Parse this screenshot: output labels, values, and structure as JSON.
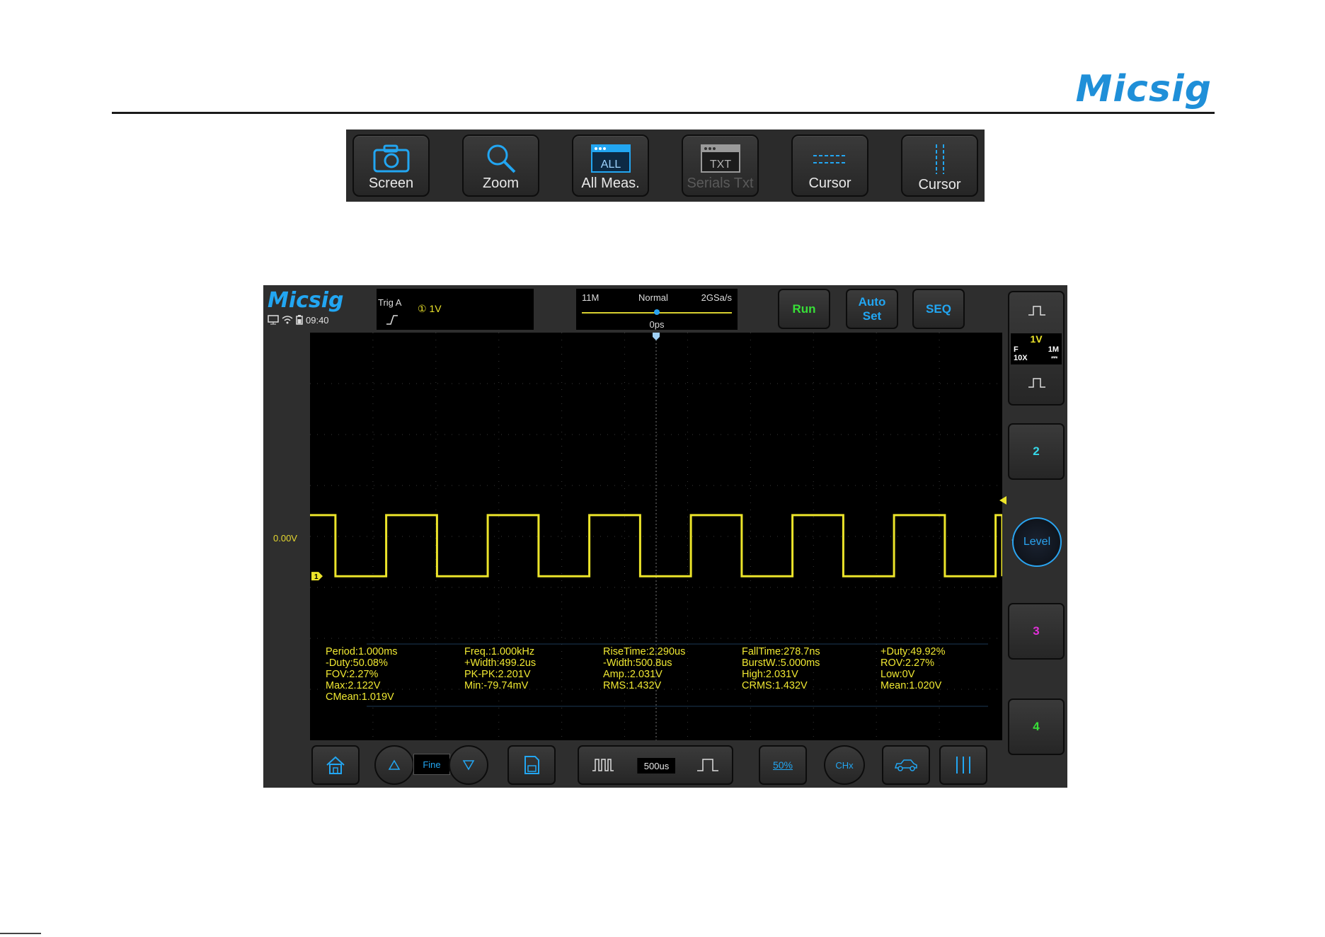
{
  "page": {
    "brand": "Micsig"
  },
  "toolbar": {
    "items": [
      {
        "label": "Screen",
        "icon": "camera-icon",
        "enabled": true
      },
      {
        "label": "Zoom",
        "icon": "magnifier-icon",
        "enabled": true
      },
      {
        "label": "All Meas.",
        "icon": "all-meas-icon",
        "badge": "ALL",
        "enabled": true
      },
      {
        "label": "Serials Txt",
        "icon": "txt-icon",
        "badge": "TXT",
        "enabled": false
      },
      {
        "label": "Cursor",
        "icon": "horizontal-cursor-icon",
        "enabled": true
      },
      {
        "label": "Cursor",
        "icon": "vertical-cursor-icon",
        "enabled": true
      }
    ]
  },
  "scope": {
    "logo": "Micsig",
    "time": "09:40",
    "trigger": {
      "label": "Trig  A",
      "channel_level": "① 1V"
    },
    "horizontal": {
      "memory_depth": "11M",
      "mode": "Normal",
      "sample_rate": "2GSa/s",
      "position": "0ps"
    },
    "buttons": {
      "run": "Run",
      "auto_line1": "Auto",
      "auto_line2": "Set",
      "seq": "SEQ"
    },
    "ch1": {
      "scale": "1V",
      "coupling": "F",
      "impedance": "1M",
      "probe": "10X",
      "dc": "⎓",
      "marker": "1"
    },
    "ch2": "2",
    "ch3": "3",
    "ch4": "4",
    "level": "Level",
    "offset_label": "0.00V",
    "fine": "Fine",
    "timebase": "500us",
    "fifty_percent": "50%",
    "chx": "CHx",
    "colors": {
      "ch1": "#ece42a",
      "ch2": "#36d8e8",
      "ch3": "#e030d8",
      "ch4": "#38e038",
      "accent": "#22a6f2"
    },
    "measurements": [
      [
        "Period:1.000ms",
        "-Duty:50.08%",
        "FOV:2.27%",
        "Max:2.122V",
        "CMean:1.019V"
      ],
      [
        "Freq.:1.000kHz",
        "+Width:499.2us",
        "PK-PK:2.201V",
        "Min:-79.74mV"
      ],
      [
        "RiseTime:2.290us",
        "-Width:500.8us",
        "Amp.:2.031V",
        "RMS:1.432V"
      ],
      [
        "FallTime:278.7ns",
        "BurstW.:5.000ms",
        "High:2.031V",
        "CRMS:1.432V"
      ],
      [
        "+Duty:49.92%",
        "ROV:2.27%",
        "Low:0V",
        "Mean:1.020V"
      ]
    ],
    "waveform": {
      "type": "square",
      "period_divisions": 2,
      "duty": 0.5,
      "high_volts": 2.031,
      "low_volts": 0
    }
  }
}
